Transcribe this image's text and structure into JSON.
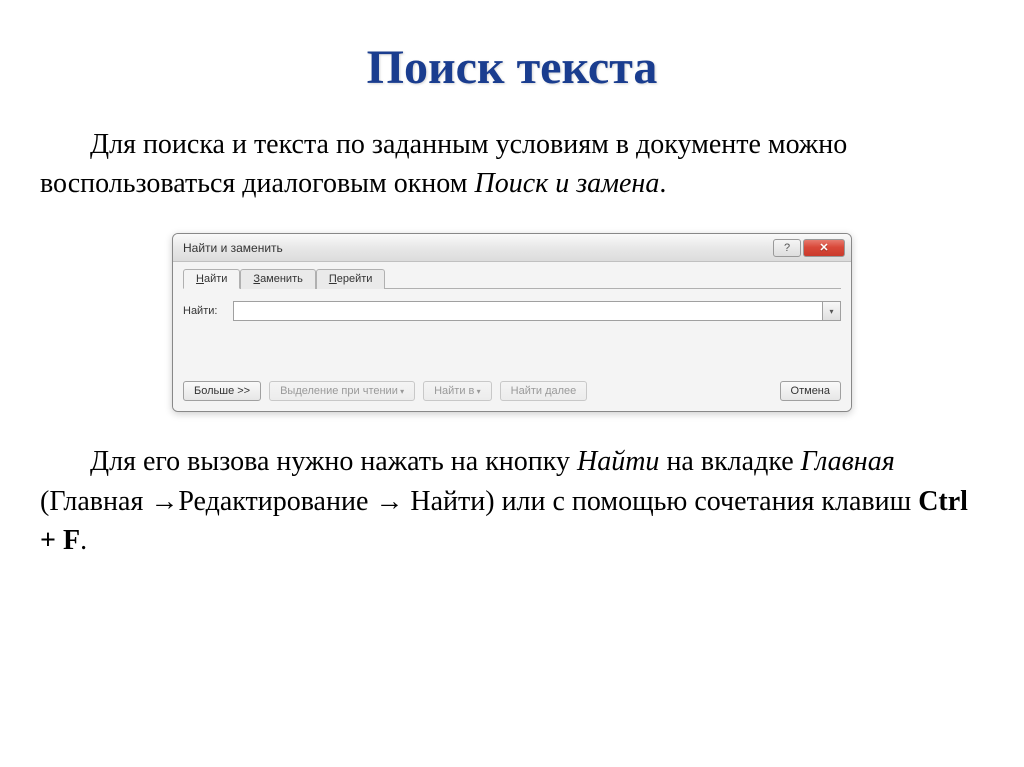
{
  "slide": {
    "title": "Поиск текста",
    "intro_before": "Для поиска и текста по заданным условиям в документе можно воспользоваться диалоговым окном ",
    "intro_italic": "Поиск и замена",
    "intro_after": ".",
    "outro_part1": "Для его вызова нужно нажать на кнопку ",
    "outro_italic1": "Найти",
    "outro_part2": " на вкладке ",
    "outro_italic2": "Главная",
    "outro_part3": " (Главная →Редактирование → Найти) или с помощью сочетания клавиш ",
    "outro_bold": "Ctrl + F",
    "outro_part4": "."
  },
  "dialog": {
    "title": "Найти и заменить",
    "help_symbol": "?",
    "close_symbol": "✕",
    "tabs": [
      {
        "prefix": "Н",
        "rest": "айти"
      },
      {
        "prefix": "З",
        "rest": "аменить"
      },
      {
        "prefix": "П",
        "rest": "ерейти"
      }
    ],
    "input_label": "Найти:",
    "buttons": {
      "more": "Больше >>",
      "highlight": "Выделение при чтении",
      "find_in": "Найти в",
      "find_next": "Найти далее",
      "cancel": "Отмена"
    }
  }
}
